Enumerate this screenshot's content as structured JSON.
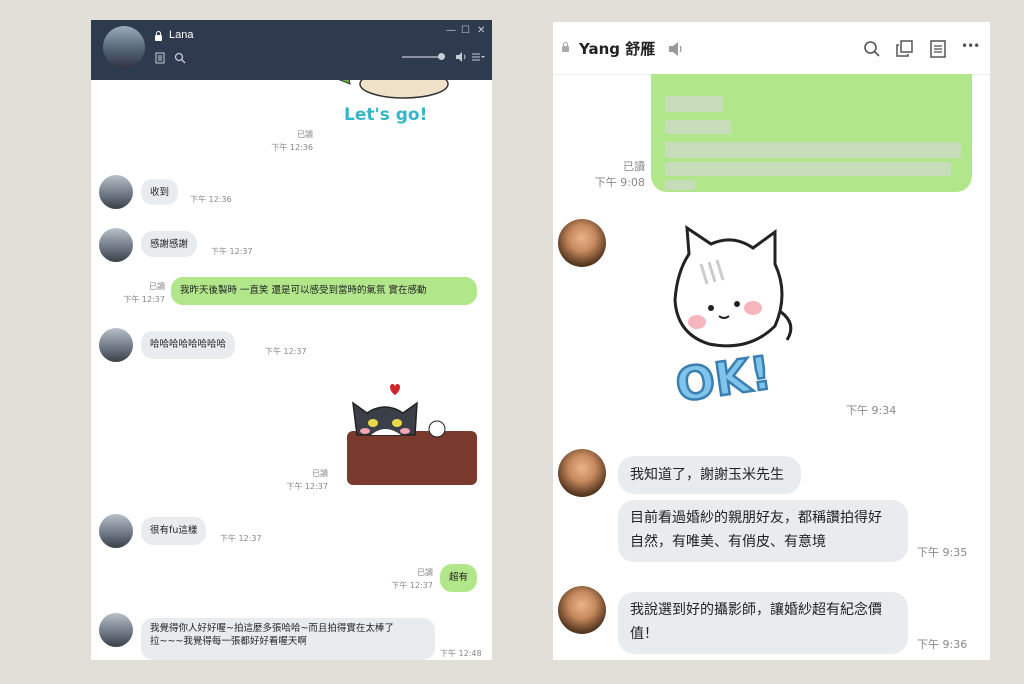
{
  "left_window": {
    "contact_name": "Lana",
    "controls": {
      "minimize": "—",
      "maximize": "☐",
      "close": "✕"
    },
    "icons": [
      "lock-icon",
      "notes-icon",
      "search-icon",
      "volume-icon",
      "menu-icon"
    ],
    "sticker_text": "Let's go!",
    "messages": [
      {
        "read": "已讀",
        "time": "下午 12:36"
      },
      {
        "text": "收到",
        "time": "下午 12:36"
      },
      {
        "text": "感謝感謝",
        "time": "下午 12:37"
      },
      {
        "text": "我昨天後製時 一直笑  還是可以感受到當時的氣氛  實在感動",
        "read": "已讀",
        "time": "下午 12:37"
      },
      {
        "text": "哈哈哈哈哈哈哈哈",
        "time": "下午 12:37"
      },
      {
        "read": "已讀",
        "time": "下午 12:37"
      },
      {
        "text": "很有fu這樣",
        "time": "下午 12:37"
      },
      {
        "text": "超有",
        "read": "已讀",
        "time": "下午 12:37"
      },
      {
        "line1": "我覺得你人好好喔~拍這麼多張哈哈~而且拍得實在太棒了",
        "line2": "拉~~~我覺得每一張都好好看喔天啊",
        "time": "下午 12:48"
      }
    ]
  },
  "right_window": {
    "contact_name": "Yang 舒雁",
    "icons": [
      "lock-icon",
      "mute-icon",
      "search-icon",
      "copy-icon",
      "notes-icon",
      "more-icon"
    ],
    "more_label": "•••",
    "sticker_text": "OK!",
    "messages": [
      {
        "read": "已讀",
        "time": "下午 9:08"
      },
      {
        "time": "下午 9:34"
      },
      {
        "text": "我知道了，謝謝玉米先生"
      },
      {
        "line1": "目前看過婚紗的親朋好友，都稱讚拍得好",
        "line2": "自然，有唯美、有俏皮、有意境",
        "time": "下午 9:35"
      },
      {
        "line1": "我說選到好的攝影師，讓婚紗超有紀念價",
        "line2": "值！",
        "time": "下午 9:36"
      }
    ]
  },
  "colors": {
    "bubble_out": "#b2e68a",
    "bubble_in": "#e9ecef",
    "header_dark": "#2e3a4e"
  }
}
